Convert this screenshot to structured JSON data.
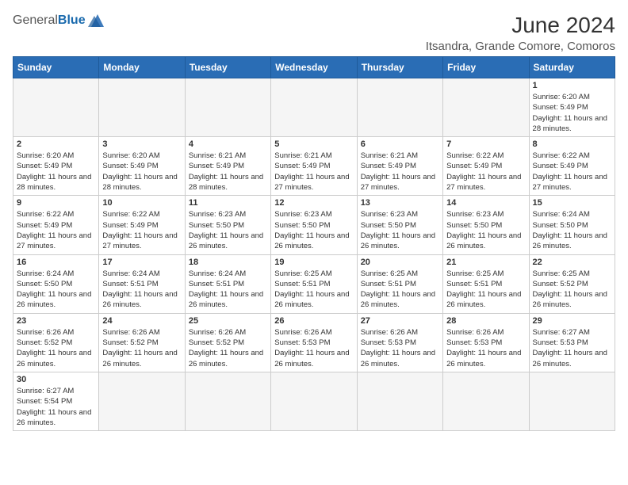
{
  "header": {
    "logo": {
      "general": "General",
      "blue": "Blue"
    },
    "title": "June 2024",
    "location": "Itsandra, Grande Comore, Comoros"
  },
  "weekdays": [
    "Sunday",
    "Monday",
    "Tuesday",
    "Wednesday",
    "Thursday",
    "Friday",
    "Saturday"
  ],
  "weeks": [
    [
      {
        "day": null
      },
      {
        "day": null
      },
      {
        "day": null
      },
      {
        "day": null
      },
      {
        "day": null
      },
      {
        "day": null
      },
      {
        "day": 1,
        "sunrise": "6:20 AM",
        "sunset": "5:49 PM",
        "daylight": "11 hours and 28 minutes."
      }
    ],
    [
      {
        "day": 2,
        "sunrise": "6:20 AM",
        "sunset": "5:49 PM",
        "daylight": "11 hours and 28 minutes."
      },
      {
        "day": 3,
        "sunrise": "6:20 AM",
        "sunset": "5:49 PM",
        "daylight": "11 hours and 28 minutes."
      },
      {
        "day": 4,
        "sunrise": "6:21 AM",
        "sunset": "5:49 PM",
        "daylight": "11 hours and 28 minutes."
      },
      {
        "day": 5,
        "sunrise": "6:21 AM",
        "sunset": "5:49 PM",
        "daylight": "11 hours and 27 minutes."
      },
      {
        "day": 6,
        "sunrise": "6:21 AM",
        "sunset": "5:49 PM",
        "daylight": "11 hours and 27 minutes."
      },
      {
        "day": 7,
        "sunrise": "6:22 AM",
        "sunset": "5:49 PM",
        "daylight": "11 hours and 27 minutes."
      },
      {
        "day": 8,
        "sunrise": "6:22 AM",
        "sunset": "5:49 PM",
        "daylight": "11 hours and 27 minutes."
      }
    ],
    [
      {
        "day": 9,
        "sunrise": "6:22 AM",
        "sunset": "5:49 PM",
        "daylight": "11 hours and 27 minutes."
      },
      {
        "day": 10,
        "sunrise": "6:22 AM",
        "sunset": "5:49 PM",
        "daylight": "11 hours and 27 minutes."
      },
      {
        "day": 11,
        "sunrise": "6:23 AM",
        "sunset": "5:50 PM",
        "daylight": "11 hours and 26 minutes."
      },
      {
        "day": 12,
        "sunrise": "6:23 AM",
        "sunset": "5:50 PM",
        "daylight": "11 hours and 26 minutes."
      },
      {
        "day": 13,
        "sunrise": "6:23 AM",
        "sunset": "5:50 PM",
        "daylight": "11 hours and 26 minutes."
      },
      {
        "day": 14,
        "sunrise": "6:23 AM",
        "sunset": "5:50 PM",
        "daylight": "11 hours and 26 minutes."
      },
      {
        "day": 15,
        "sunrise": "6:24 AM",
        "sunset": "5:50 PM",
        "daylight": "11 hours and 26 minutes."
      }
    ],
    [
      {
        "day": 16,
        "sunrise": "6:24 AM",
        "sunset": "5:50 PM",
        "daylight": "11 hours and 26 minutes."
      },
      {
        "day": 17,
        "sunrise": "6:24 AM",
        "sunset": "5:51 PM",
        "daylight": "11 hours and 26 minutes."
      },
      {
        "day": 18,
        "sunrise": "6:24 AM",
        "sunset": "5:51 PM",
        "daylight": "11 hours and 26 minutes."
      },
      {
        "day": 19,
        "sunrise": "6:25 AM",
        "sunset": "5:51 PM",
        "daylight": "11 hours and 26 minutes."
      },
      {
        "day": 20,
        "sunrise": "6:25 AM",
        "sunset": "5:51 PM",
        "daylight": "11 hours and 26 minutes."
      },
      {
        "day": 21,
        "sunrise": "6:25 AM",
        "sunset": "5:51 PM",
        "daylight": "11 hours and 26 minutes."
      },
      {
        "day": 22,
        "sunrise": "6:25 AM",
        "sunset": "5:52 PM",
        "daylight": "11 hours and 26 minutes."
      }
    ],
    [
      {
        "day": 23,
        "sunrise": "6:26 AM",
        "sunset": "5:52 PM",
        "daylight": "11 hours and 26 minutes."
      },
      {
        "day": 24,
        "sunrise": "6:26 AM",
        "sunset": "5:52 PM",
        "daylight": "11 hours and 26 minutes."
      },
      {
        "day": 25,
        "sunrise": "6:26 AM",
        "sunset": "5:52 PM",
        "daylight": "11 hours and 26 minutes."
      },
      {
        "day": 26,
        "sunrise": "6:26 AM",
        "sunset": "5:53 PM",
        "daylight": "11 hours and 26 minutes."
      },
      {
        "day": 27,
        "sunrise": "6:26 AM",
        "sunset": "5:53 PM",
        "daylight": "11 hours and 26 minutes."
      },
      {
        "day": 28,
        "sunrise": "6:26 AM",
        "sunset": "5:53 PM",
        "daylight": "11 hours and 26 minutes."
      },
      {
        "day": 29,
        "sunrise": "6:27 AM",
        "sunset": "5:53 PM",
        "daylight": "11 hours and 26 minutes."
      }
    ],
    [
      {
        "day": 30,
        "sunrise": "6:27 AM",
        "sunset": "5:54 PM",
        "daylight": "11 hours and 26 minutes."
      },
      {
        "day": null
      },
      {
        "day": null
      },
      {
        "day": null
      },
      {
        "day": null
      },
      {
        "day": null
      },
      {
        "day": null
      }
    ]
  ],
  "labels": {
    "sunrise": "Sunrise:",
    "sunset": "Sunset:",
    "daylight": "Daylight:"
  }
}
